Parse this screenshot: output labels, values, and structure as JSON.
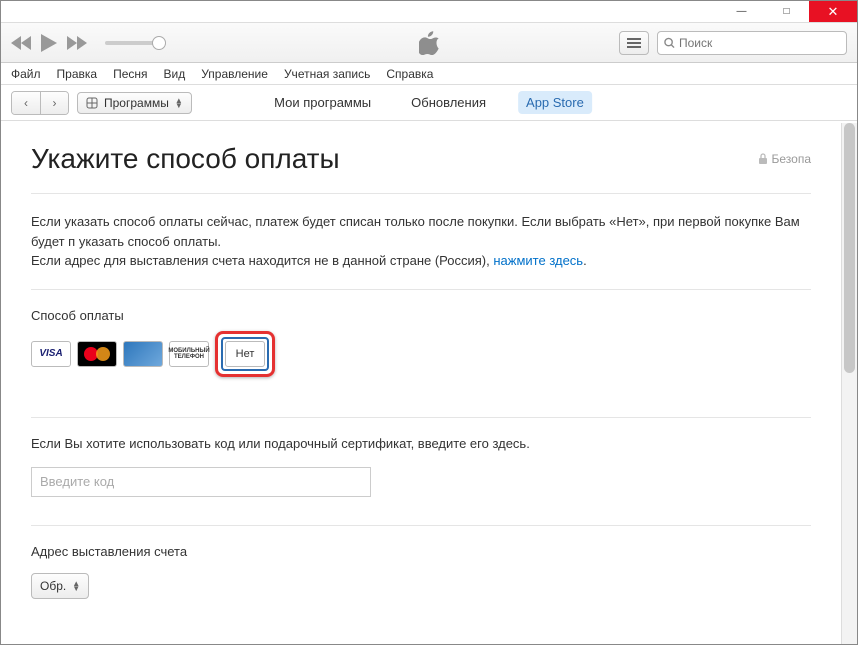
{
  "titlebar": {
    "minimize": "—",
    "maximize": "□",
    "close": "✕"
  },
  "menubar": [
    "Файл",
    "Правка",
    "Песня",
    "Вид",
    "Управление",
    "Учетная запись",
    "Справка"
  ],
  "search": {
    "placeholder": "Поиск"
  },
  "category": {
    "label": "Программы"
  },
  "tabs": {
    "items": [
      {
        "label": "Мои программы",
        "active": false
      },
      {
        "label": "Обновления",
        "active": false
      },
      {
        "label": "App Store",
        "active": true
      }
    ]
  },
  "page": {
    "title": "Укажите способ оплаты",
    "secure_label": "Безопа",
    "intro1": "Если указать способ оплаты сейчас, платеж будет списан только после покупки. Если выбрать «Нет», при первой покупке Вам будет п указать способ оплаты.",
    "intro2_prefix": "Если адрес для выставления счета находится не в данной стране (Россия), ",
    "intro2_link": "нажмите здесь",
    "intro2_suffix": ".",
    "payment_label": "Способ оплаты",
    "cards": {
      "visa": "VISA",
      "mobile_line1": "МОБИЛЬНЫЙ",
      "mobile_line2": "ТЕЛЕФОН",
      "none": "Нет"
    },
    "giftcode_label": "Если Вы хотите использовать код или подарочный сертификат, введите его здесь.",
    "giftcode_placeholder": "Введите код",
    "billing_label": "Адрес выставления счета",
    "salutation": "Обр."
  }
}
